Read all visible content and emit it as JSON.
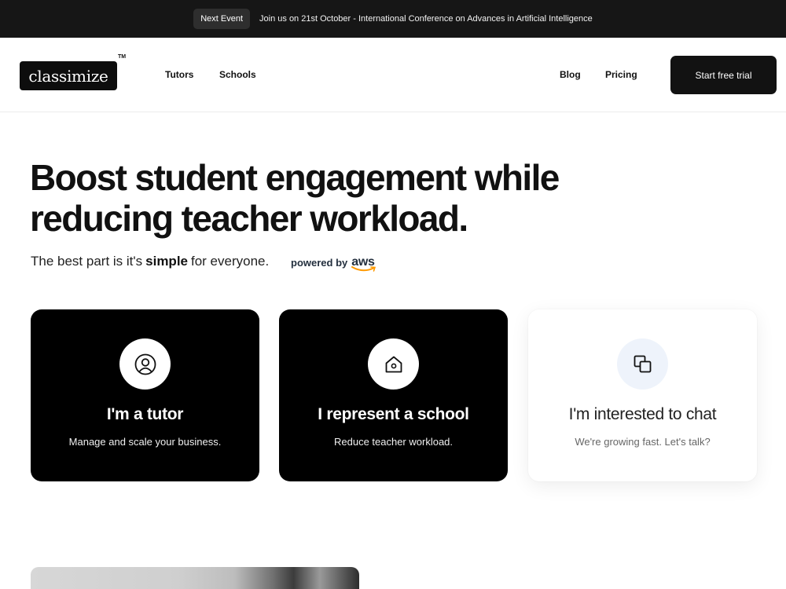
{
  "announcement": {
    "pill_label": "Next Event",
    "text": "Join us on 21st October - International Conference on Advances in Artificial Intelligence"
  },
  "nav": {
    "logo_text": "classimize",
    "trademark": "TM",
    "links_left": [
      "Tutors",
      "Schools"
    ],
    "links_right": [
      "Blog",
      "Pricing"
    ],
    "cta_label": "Start free trial"
  },
  "hero": {
    "title": "Boost student engagement while reducing teacher workload.",
    "subtitle_prefix": "The best part is it's",
    "subtitle_emphasis": "simple",
    "subtitle_suffix": "for everyone.",
    "powered_by": "powered by",
    "aws_label": "aws"
  },
  "cards": [
    {
      "icon": "user-circle-icon",
      "title": "I'm a tutor",
      "description": "Manage and scale your business."
    },
    {
      "icon": "home-icon",
      "title": "I represent a school",
      "description": "Reduce teacher workload."
    },
    {
      "icon": "chat-squares-icon",
      "title": "I'm interested to chat",
      "description": "We're growing fast. Let's talk?"
    }
  ],
  "colors": {
    "topbar_bg": "#161616",
    "card_dark_bg": "#000000",
    "icon_bg_light": "#eef3fb",
    "aws_orange": "#ff9900"
  }
}
